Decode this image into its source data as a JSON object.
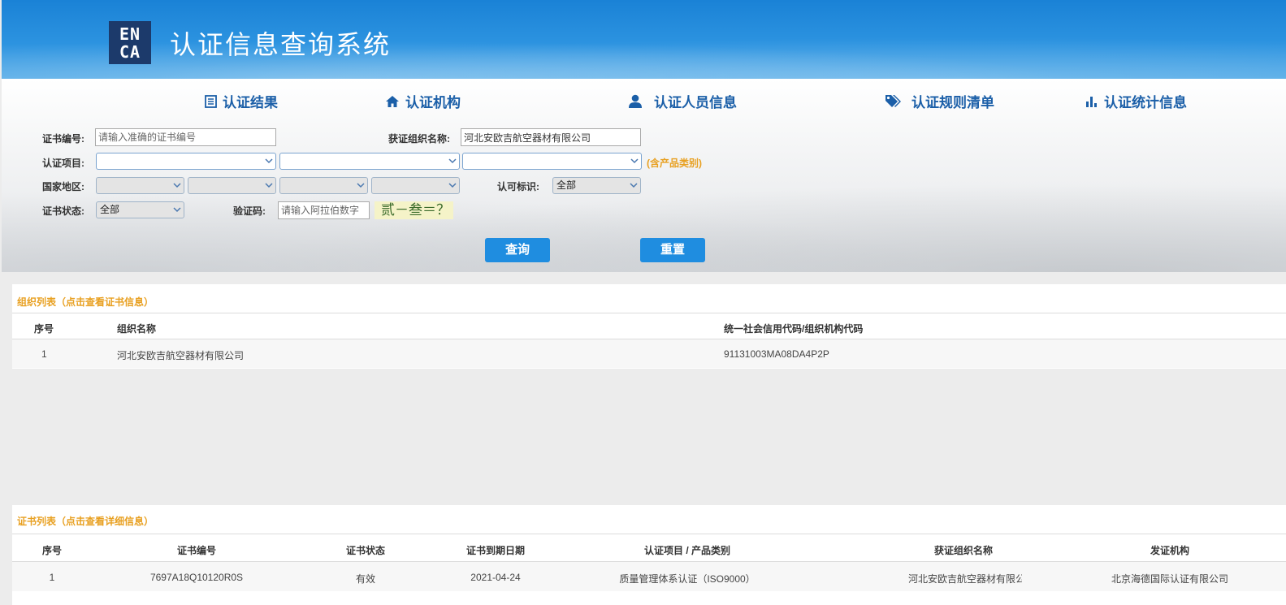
{
  "header": {
    "logo_top": "EN",
    "logo_bottom": "CA",
    "title": "认证信息查询系统"
  },
  "nav": [
    {
      "label": "认证结果",
      "icon": "list-icon"
    },
    {
      "label": "认证机构",
      "icon": "home-icon"
    },
    {
      "label": "认证人员信息",
      "icon": "user-icon"
    },
    {
      "label": "认证规则清单",
      "icon": "tags-icon"
    },
    {
      "label": "认证统计信息",
      "icon": "bar-chart-icon"
    }
  ],
  "form": {
    "cert_no_label": "证书编号:",
    "cert_no_placeholder": "请输入准确的证书编号",
    "org_name_label": "获证组织名称:",
    "org_name_value": "河北安欧吉航空器材有限公司",
    "project_label": "认证项目:",
    "product_note": "(含产品类别)",
    "region_label": "国家地区:",
    "accred_label": "认可标识:",
    "accred_value": "全部",
    "status_label": "证书状态:",
    "status_value": "全部",
    "captcha_label": "验证码:",
    "captcha_placeholder": "请输入阿拉伯数字",
    "captcha_text": "贰－叁＝？",
    "query_button": "查询",
    "reset_button": "重置"
  },
  "org_list": {
    "title": "组织列表（点击查看证书信息）",
    "headers": [
      "序号",
      "组织名称",
      "统一社会信用代码/组织机构代码"
    ],
    "rows": [
      [
        "1",
        "河北安欧吉航空器材有限公司",
        "91131003MA08DA4P2P"
      ]
    ]
  },
  "cert_list": {
    "title": "证书列表（点击查看详细信息）",
    "headers": [
      "序号",
      "证书编号",
      "证书状态",
      "证书到期日期",
      "认证项目 / 产品类别",
      "获证组织名称",
      "发证机构"
    ],
    "rows": [
      [
        "1",
        "7697A18Q10120R0S",
        "有效",
        "2021-04-24",
        "质量管理体系认证（ISO9000）",
        "河北安欧吉航空器材有限公",
        "北京海德国际认证有限公司"
      ]
    ]
  },
  "colors": {
    "banner": "#1a82d6",
    "nav_text": "#1b5fa8",
    "accent_orange": "#e8a021",
    "button": "#1f8de0"
  }
}
